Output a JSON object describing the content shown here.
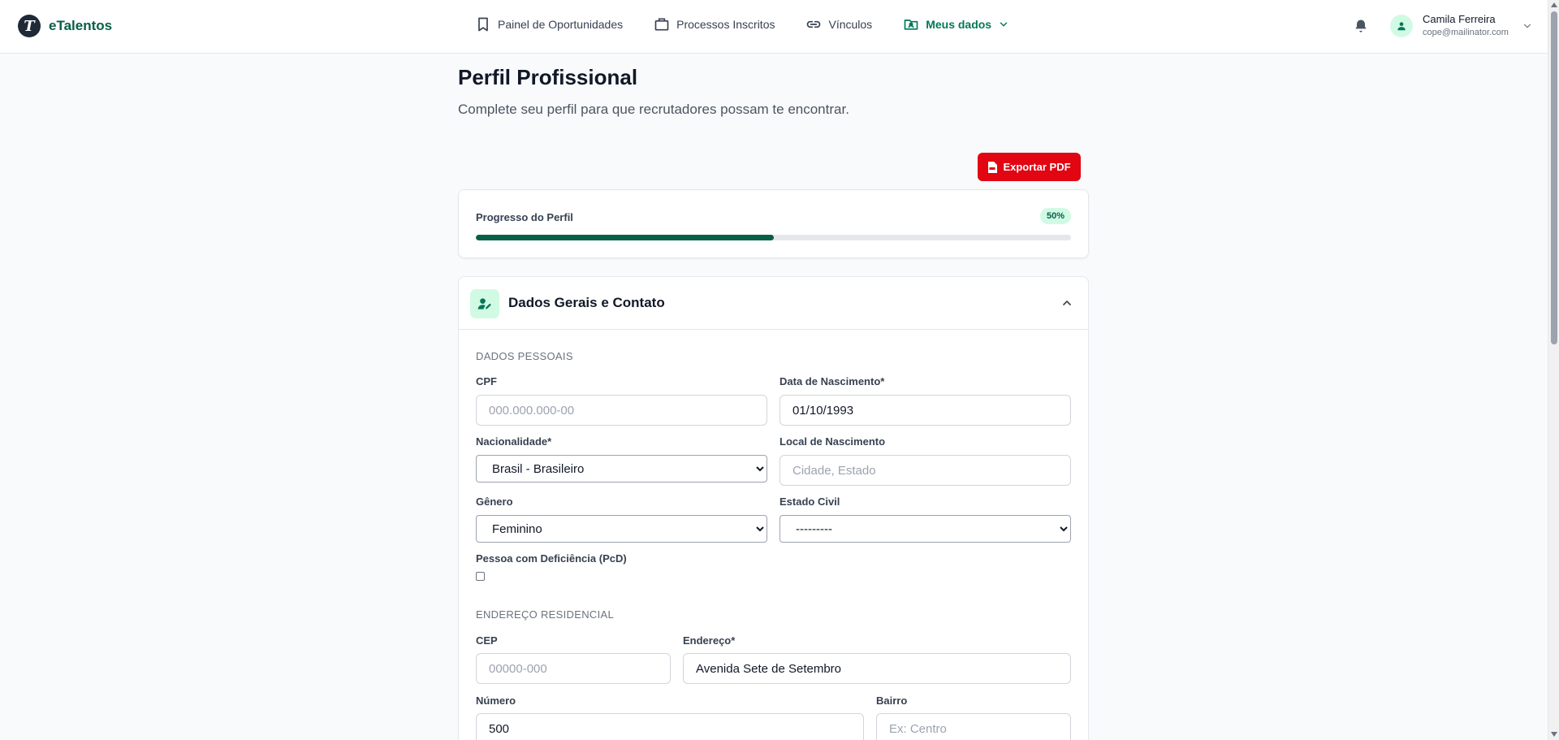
{
  "brand": {
    "logo_letter": "T",
    "name": "eTalentos"
  },
  "nav": {
    "items": [
      {
        "label": "Painel de Oportunidades",
        "icon": "bookmark-icon"
      },
      {
        "label": "Processos Inscritos",
        "icon": "briefcase-icon"
      },
      {
        "label": "Vínculos",
        "icon": "link-icon"
      },
      {
        "label": "Meus dados",
        "icon": "folder-user-icon",
        "active": true
      }
    ]
  },
  "user": {
    "name": "Camila Ferreira",
    "email": "cope@mailinator.com"
  },
  "page": {
    "title": "Perfil Profissional",
    "subtitle": "Complete seu perfil para que recrutadores possam te encontrar."
  },
  "export_button": {
    "label": "Exportar PDF"
  },
  "progress": {
    "label": "Progresso do Perfil",
    "value_text": "50%",
    "value_fraction": 0.5
  },
  "section": {
    "title": "Dados Gerais e Contato",
    "personal": {
      "group_title": "DADOS PESSOAIS",
      "cpf": {
        "label": "CPF",
        "value": "",
        "placeholder": "000.000.000-00"
      },
      "birth_date": {
        "label": "Data de Nascimento*",
        "value": "01/10/1993",
        "placeholder": ""
      },
      "nationality": {
        "label": "Nacionalidade*",
        "selected": "Brasil - Brasileiro"
      },
      "birth_place": {
        "label": "Local de Nascimento",
        "value": "",
        "placeholder": "Cidade, Estado"
      },
      "gender": {
        "label": "Gênero",
        "selected": "Feminino"
      },
      "marital_status": {
        "label": "Estado Civil",
        "selected": "---------"
      },
      "pcd": {
        "label": "Pessoa com Deficiência (PcD)",
        "checked": false
      }
    },
    "address": {
      "group_title": "ENDEREÇO RESIDENCIAL",
      "cep": {
        "label": "CEP",
        "value": "",
        "placeholder": "00000-000"
      },
      "street": {
        "label": "Endereço*",
        "value": "Avenida Sete de Setembro",
        "placeholder": ""
      },
      "number": {
        "label": "Número",
        "value": "500",
        "placeholder": ""
      },
      "district": {
        "label": "Bairro",
        "value": "",
        "placeholder": "Ex: Centro"
      }
    }
  },
  "colors": {
    "brand_green": "#065f46",
    "accent_green": "#047857",
    "export_red": "#e10612",
    "badge_bg": "#d1fae5"
  }
}
